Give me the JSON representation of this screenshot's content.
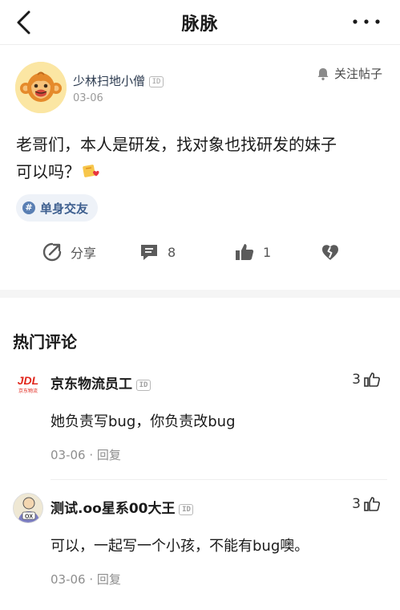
{
  "nav": {
    "title": "脉脉"
  },
  "post": {
    "author": "少林扫地小僧",
    "id_badge": "ID",
    "date": "03-06",
    "follow_label": "关注帖子",
    "content_line1": "老哥们，本人是研发，找对象也找研发的妹子",
    "content_line2": "可以吗？",
    "emoji": "heart-gift-emoji",
    "topic": "单身交友",
    "topic_symbol": "#",
    "actions": {
      "share_label": "分享",
      "comment_count": "8",
      "like_count": "1"
    }
  },
  "comments_section": {
    "title": "热门评论",
    "comments": [
      {
        "author": "京东物流员工",
        "id_badge": "ID",
        "avatar_text": "JDL",
        "avatar_sub": "京东物流",
        "likes": "3",
        "text": "她负责写bug，你负责改bug",
        "date": "03-06",
        "reply": "回复"
      },
      {
        "author": "测试.oo星系00大王",
        "id_badge": "ID",
        "avatar_text": "OX",
        "likes": "3",
        "text": "可以，一起写一个小孩，不能有bug噢。",
        "date": "03-06",
        "reply": "回复"
      }
    ]
  },
  "colors": {
    "topic_bg": "#eef2f8",
    "topic_text": "#3e5f8f",
    "meta_gray": "#8e8e8e",
    "jdl_red": "#e1251b"
  },
  "icons": [
    "back-arrow-icon",
    "more-dots-icon",
    "bell-icon",
    "share-icon",
    "comment-icon",
    "thumbs-up-icon",
    "broken-heart-icon"
  ]
}
